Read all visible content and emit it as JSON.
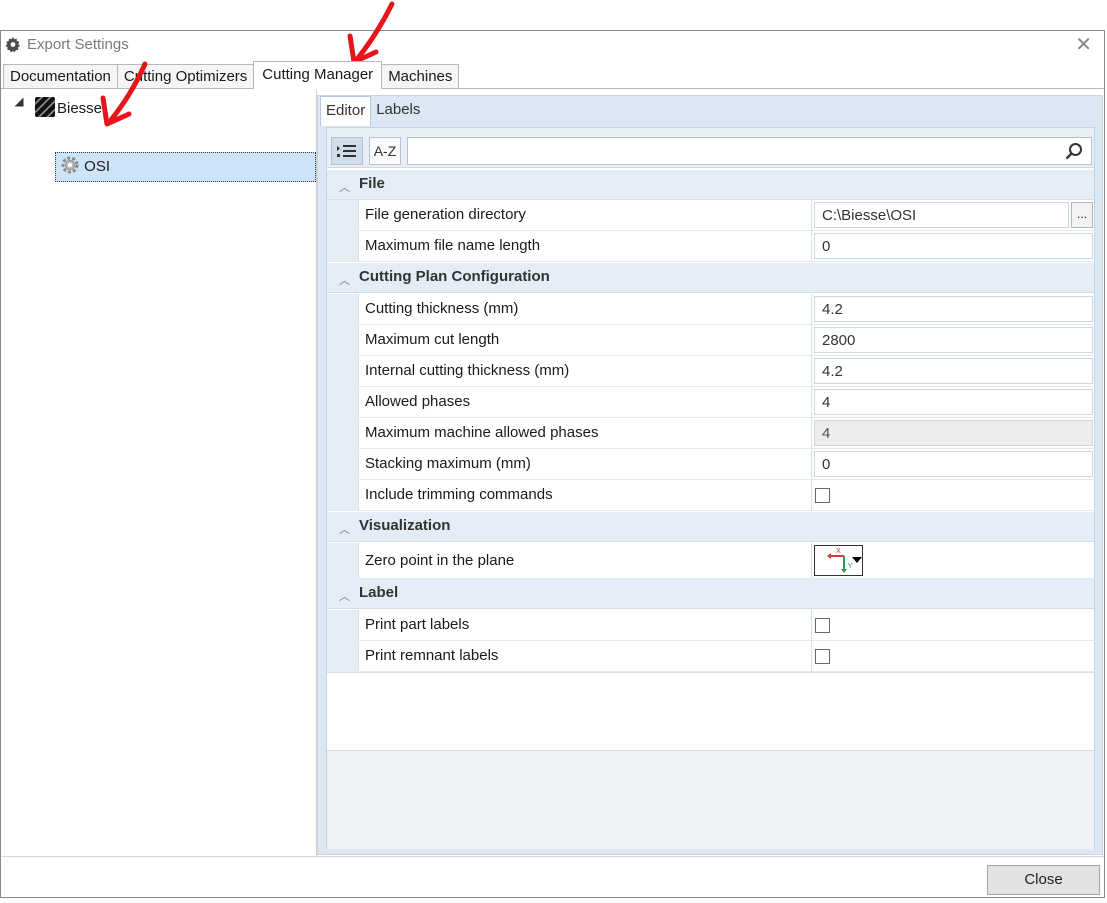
{
  "window": {
    "title": "Export Settings",
    "close_glyph": "✕",
    "icon": "gear-icon"
  },
  "tabs": [
    {
      "label": "Documentation"
    },
    {
      "label": "Cutting Optimizers"
    },
    {
      "label": "Cutting Manager",
      "active": true
    },
    {
      "label": "Machines"
    }
  ],
  "tree": {
    "root": {
      "label": "Biesse",
      "icon": "biesse-logo-icon"
    },
    "child": {
      "label": "OSI",
      "icon": "gear-icon",
      "selected": true
    }
  },
  "subtabs": [
    {
      "label": "Editor",
      "active": true
    },
    {
      "label": "Labels"
    }
  ],
  "toolbar": {
    "categorized_icon": "categorized-list-icon",
    "az_label": "A-Z",
    "search_value": "",
    "search_icon": "magnifier-icon"
  },
  "categories": [
    {
      "label": "File",
      "rows": [
        {
          "name": "File generation directory",
          "value": "C:\\Biesse\\OSI",
          "type": "path",
          "browse_label": "..."
        },
        {
          "name": "Maximum file name length",
          "value": "0",
          "type": "text"
        }
      ]
    },
    {
      "label": "Cutting Plan Configuration",
      "rows": [
        {
          "name": "Cutting thickness (mm)",
          "value": "4.2",
          "type": "text"
        },
        {
          "name": "Maximum cut length",
          "value": "2800",
          "type": "text"
        },
        {
          "name": "Internal cutting thickness (mm)",
          "value": "4.2",
          "type": "text"
        },
        {
          "name": "Allowed phases",
          "value": "4",
          "type": "text"
        },
        {
          "name": "Maximum machine allowed phases",
          "value": "4",
          "type": "disabled"
        },
        {
          "name": "Stacking maximum (mm)",
          "value": "0",
          "type": "text"
        },
        {
          "name": "Include trimming commands",
          "checked": false,
          "type": "checkbox"
        }
      ]
    },
    {
      "label": "Visualization",
      "rows": [
        {
          "name": "Zero point in the plane",
          "type": "zero-point",
          "axis_x": "X",
          "axis_y": "Y"
        }
      ]
    },
    {
      "label": "Label",
      "rows": [
        {
          "name": "Print part labels",
          "checked": false,
          "type": "checkbox"
        },
        {
          "name": "Print remnant labels",
          "checked": false,
          "type": "checkbox"
        }
      ]
    }
  ],
  "footer": {
    "close_label": "Close"
  },
  "annotation_color": "#e8141c"
}
